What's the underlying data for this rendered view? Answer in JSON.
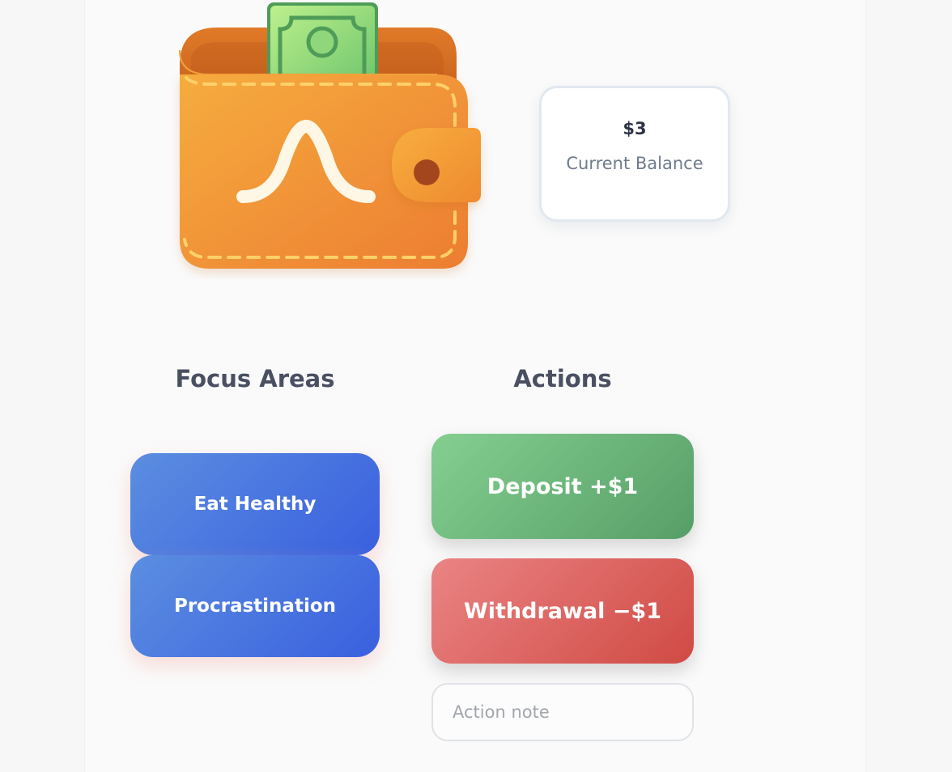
{
  "balance": {
    "amount": "$3",
    "label": "Current Balance"
  },
  "focus_areas": {
    "title": "Focus Areas",
    "items": [
      {
        "label": "Eat Healthy"
      },
      {
        "label": "Procrastination"
      }
    ]
  },
  "actions": {
    "title": "Actions",
    "deposit_label": "Deposit +$1",
    "withdraw_label": "Withdrawal −$1",
    "note_placeholder": "Action note"
  },
  "colors": {
    "wallet_orange": "#f0962e",
    "focus_blue": "#4a74e0",
    "deposit_green": "#6cb87b",
    "withdraw_red": "#e06461"
  },
  "icons": {
    "wallet": "wallet-icon",
    "banknote": "banknote-icon"
  }
}
